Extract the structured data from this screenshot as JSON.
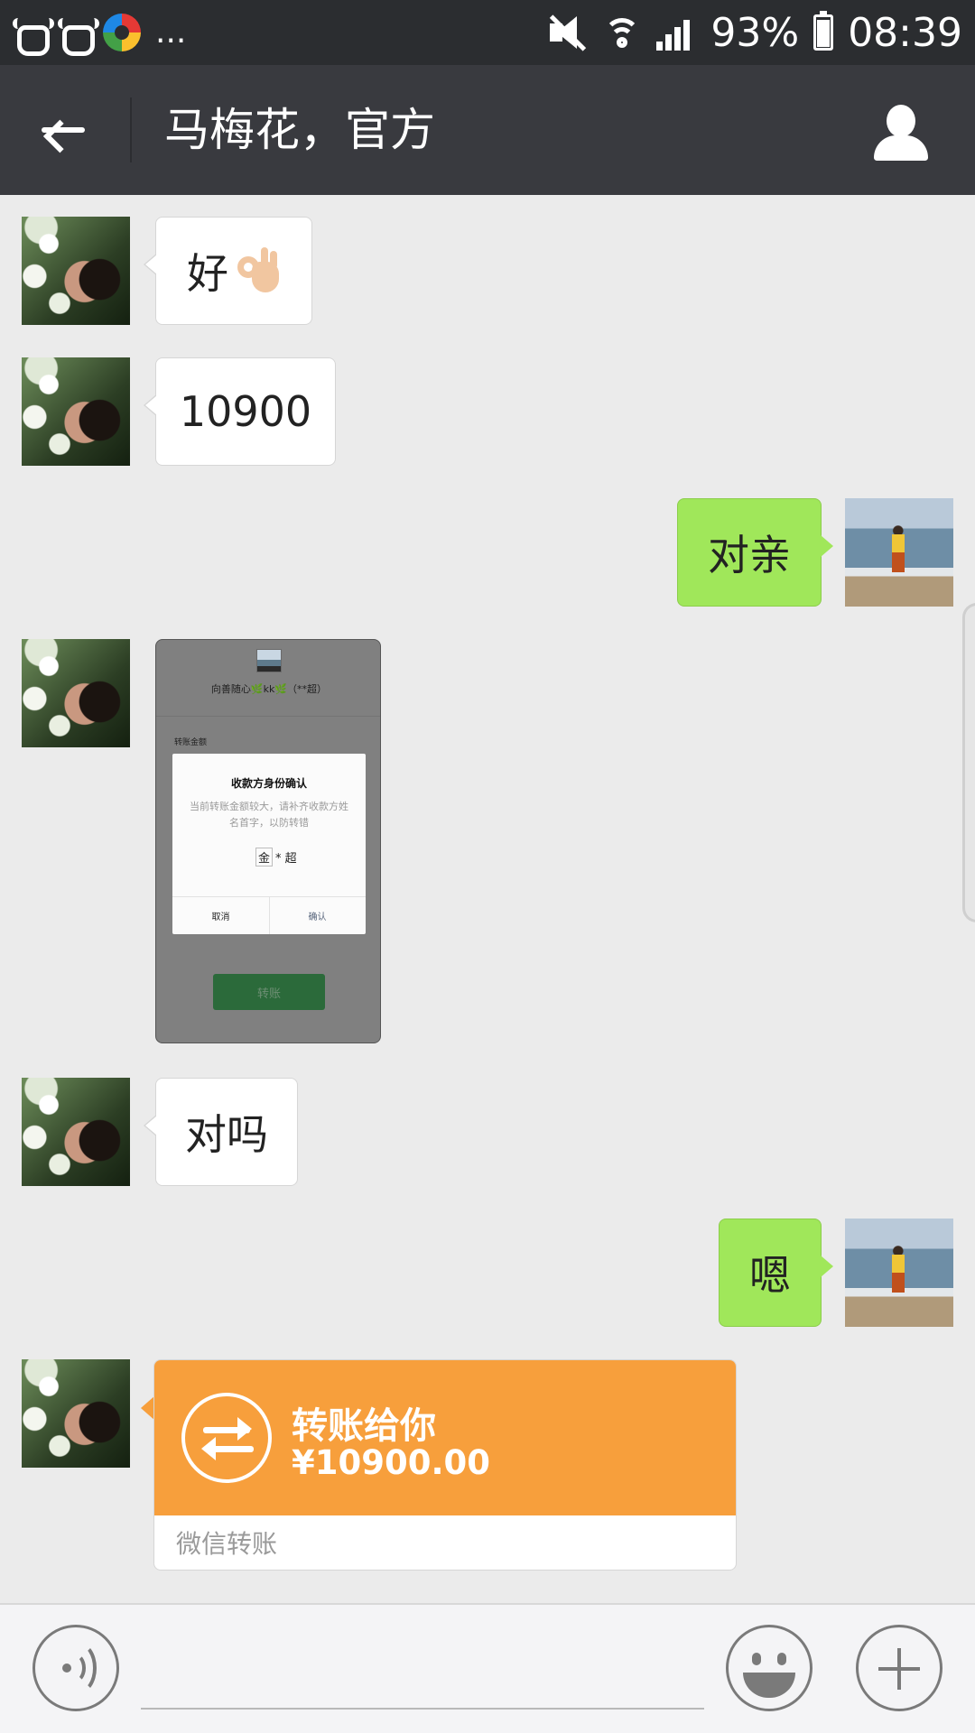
{
  "status_bar": {
    "left_more": "...",
    "battery": "93%",
    "time": "08:39"
  },
  "header": {
    "title": "马梅花，官方"
  },
  "messages": [
    {
      "from": "contact",
      "type": "text",
      "text": "好",
      "emoji": "ok-hand"
    },
    {
      "from": "contact",
      "type": "text",
      "text": "10900"
    },
    {
      "from": "me",
      "type": "text",
      "text": "对亲"
    },
    {
      "from": "contact",
      "type": "image",
      "image": {
        "header_name": "向善随心🌿kk🌿（**超）",
        "field_label": "转账金额",
        "dialog_title": "收款方身份确认",
        "dialog_text": "当前转账金额较大，请补齐收款方姓名首字，以防转错",
        "name_first": "金",
        "name_rest": "* 超",
        "cancel": "取消",
        "confirm": "确认",
        "button": "转账"
      }
    },
    {
      "from": "contact",
      "type": "text",
      "text": "对吗"
    },
    {
      "from": "me",
      "type": "text",
      "text": "嗯"
    },
    {
      "from": "contact",
      "type": "transfer",
      "title": "转账给你",
      "amount": "¥10900.00",
      "footer": "微信转账"
    }
  ],
  "input_bar": {
    "text_value": ""
  },
  "colors": {
    "header_bg": "#393a3f",
    "status_bg": "#2b2d30",
    "chat_bg": "#ebebeb",
    "outgoing_bubble": "#a0e75a",
    "transfer_orange": "#f79f3c"
  }
}
